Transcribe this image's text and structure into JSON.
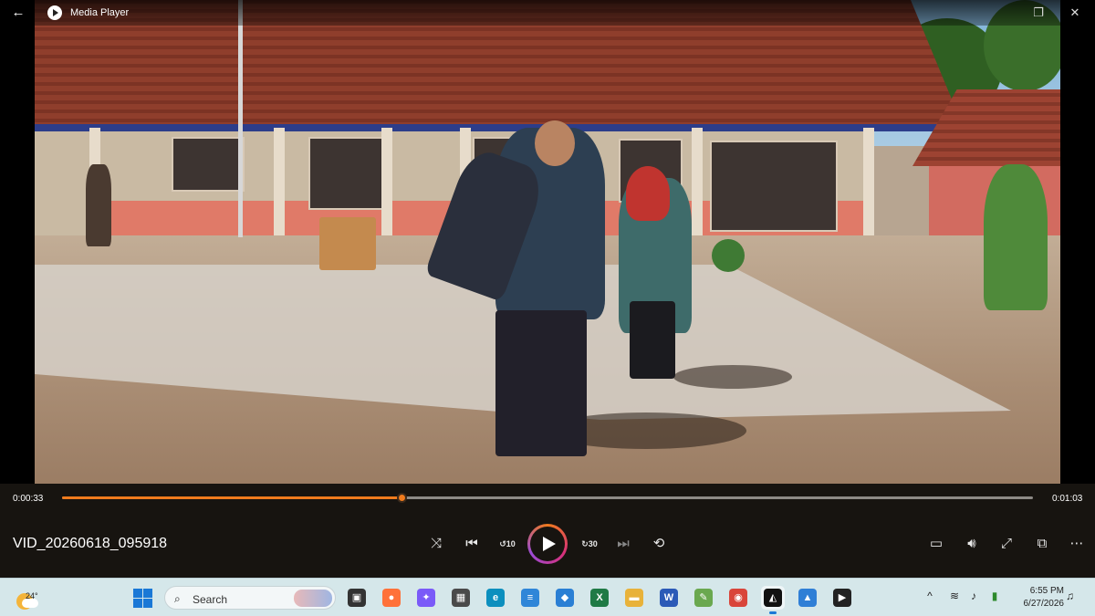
{
  "window": {
    "app_title": "Media Player",
    "back_icon": "arrow-left-icon",
    "restore_icon": "restore-icon",
    "close_icon": "close-icon"
  },
  "player": {
    "elapsed": "0:00:33",
    "duration": "0:01:03",
    "progress_fraction": 0.35,
    "file_name": "VID_20260618_095918",
    "buttons": {
      "shuffle": "shuffle-icon",
      "previous": "previous-icon",
      "skip_back": "10",
      "play": "play-icon",
      "skip_forward": "30",
      "next": "next-icon",
      "repeat": "repeat-icon",
      "captions": "captions-icon",
      "volume": "volume-icon",
      "fullscreen": "fullscreen-icon",
      "miniplayer": "miniplayer-icon",
      "more": "more-icon"
    },
    "accent_color": "#f07b1d"
  },
  "taskbar": {
    "weather_temp": "24°",
    "search_placeholder": "Search",
    "apps": [
      {
        "name": "task-view",
        "glyph": "▣",
        "color": "#333333"
      },
      {
        "name": "firefox",
        "glyph": "●",
        "color": "#ff7139"
      },
      {
        "name": "copilot",
        "glyph": "✦",
        "color": "#7a5af8"
      },
      {
        "name": "calculator",
        "glyph": "▦",
        "color": "#4a4a4a"
      },
      {
        "name": "edge",
        "glyph": "e",
        "color": "#0c8fbe"
      },
      {
        "name": "notepad",
        "glyph": "≡",
        "color": "#2f86d8"
      },
      {
        "name": "app-tiles",
        "glyph": "◆",
        "color": "#2a7fd4"
      },
      {
        "name": "excel",
        "glyph": "X",
        "color": "#1f7a45"
      },
      {
        "name": "file-explorer",
        "glyph": "▬",
        "color": "#e8b23a"
      },
      {
        "name": "word",
        "glyph": "W",
        "color": "#2b5ab7"
      },
      {
        "name": "pen-app",
        "glyph": "✎",
        "color": "#6aa84f"
      },
      {
        "name": "chrome",
        "glyph": "◉",
        "color": "#d9453a"
      },
      {
        "name": "creative-app",
        "glyph": "◭",
        "color": "#111111"
      },
      {
        "name": "photos",
        "glyph": "▲",
        "color": "#2f7fd6"
      },
      {
        "name": "media-player",
        "glyph": "▶",
        "color": "#222222"
      }
    ],
    "time": "6:55 PM",
    "date": "6/27/2026"
  }
}
